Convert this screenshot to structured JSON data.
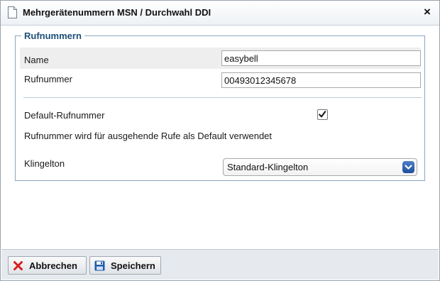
{
  "dialog": {
    "title": "Mehrgerätenummern MSN / Durchwahl DDI",
    "close_label": "×"
  },
  "group": {
    "legend": "Rufnummern",
    "name_label": "Name",
    "name_value": "easybell",
    "number_label": "Rufnummer",
    "number_value": "00493012345678",
    "default_label": "Default-Rufnummer",
    "default_checked": true,
    "default_hint": "Rufnummer wird für ausgehende Rufe als Default verwendet",
    "ringtone_label": "Klingelton",
    "ringtone_value": "Standard-Klingelton"
  },
  "footer": {
    "cancel_label": "Abbrechen",
    "save_label": "Speichern"
  },
  "icons": {
    "title": "document-icon",
    "close": "close-icon",
    "checkbox": "checkmark-icon",
    "select": "chevron-down-icon",
    "cancel": "red-x-icon",
    "save": "floppy-disk-icon"
  },
  "colors": {
    "legend": "#1d4f78",
    "group_border": "#8aa6c0",
    "select_arrow": "#1f4f9a",
    "cancel_icon": "#d61f1f",
    "save_icon": "#1e5aa8"
  }
}
